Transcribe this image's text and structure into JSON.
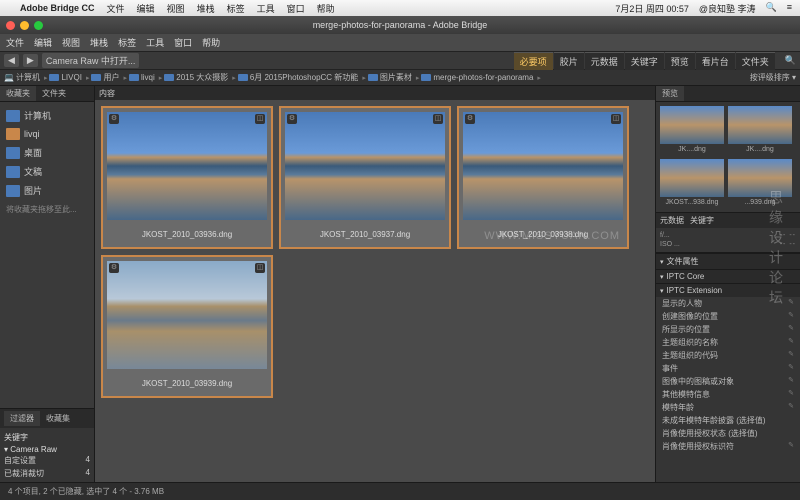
{
  "mac": {
    "app": "Adobe Bridge CC",
    "menus": [
      "文件",
      "编辑",
      "视图",
      "堆栈",
      "标签",
      "工具",
      "窗口",
      "帮助"
    ],
    "clock": "7月2日 周四 00:57",
    "user": "@良知塾 李涛",
    "search_icon": "🔍",
    "menu_icon": "≡"
  },
  "window": {
    "title": "merge-photos-for-panorama - Adobe Bridge"
  },
  "appmenu": [
    "文件",
    "编辑",
    "视图",
    "堆栈",
    "标签",
    "工具",
    "窗口",
    "帮助"
  ],
  "toolbar": {
    "cr_open": "Camera Raw 中打开...",
    "tabs": [
      "必要项",
      "胶片",
      "元数据",
      "关键字",
      "预览",
      "看片台",
      "文件夹"
    ],
    "sort": "按评级排序 ▾"
  },
  "crumbs": [
    "计算机",
    "LIVQI",
    "用户",
    "livqi",
    "2015 大众摄影",
    "6月 2015PhotoshopCC 新功能",
    "图片素材",
    "merge-photos-for-panorama"
  ],
  "left": {
    "tabs": [
      "收藏夹",
      "文件夹"
    ],
    "items": [
      {
        "icon": "comp",
        "label": "计算机"
      },
      {
        "icon": "home",
        "label": "livqi"
      },
      {
        "icon": "fold",
        "label": "桌面"
      },
      {
        "icon": "fold",
        "label": "文稿"
      },
      {
        "icon": "fold",
        "label": "图片"
      }
    ],
    "hint": "将收藏夹拖移至此...",
    "filter": {
      "tabs": [
        "过滤器",
        "收藏集"
      ],
      "section": "关键字",
      "group": "Camera Raw",
      "rows": [
        {
          "k": "自定设置",
          "v": "4"
        },
        {
          "k": "已裁消裁切",
          "v": "4"
        }
      ]
    }
  },
  "content": {
    "tab": "内容",
    "thumbs": [
      {
        "name": "JKOST_2010_03936.dng",
        "variant": ""
      },
      {
        "name": "JKOST_2010_03937.dng",
        "variant": ""
      },
      {
        "name": "JKOST_2010_03938.dng",
        "variant": ""
      },
      {
        "name": "JKOST_2010_03939.dng",
        "variant": "var2"
      }
    ]
  },
  "right": {
    "preview_tab": "预览",
    "minis": [
      {
        "l": "JK....dng"
      },
      {
        "l": "JK....dng"
      },
      {
        "l": "JKOST...938.dng"
      },
      {
        "l": "...939.dng"
      }
    ],
    "meta_tabs": [
      "元数据",
      "关键字"
    ],
    "meta": {
      "f": "f/...",
      "iso": "ISO ...",
      "exp": "--  --"
    },
    "sections": [
      "文件属性",
      "IPTC Core",
      "IPTC Extension"
    ],
    "iptc": [
      "显示的人物",
      "创建图像的位置",
      "所显示的位置",
      "主题组织的名称",
      "主题组织的代码",
      "事件",
      "图像中的图稿或对象",
      "其他模特信息",
      "模特年龄",
      "未成年模特年龄披露  (选择值)",
      "肖像使用授权状态  (选择值)",
      "肖像使用授权标识符"
    ]
  },
  "status": "4 个项目, 2 个已隐藏, 选中了 4 个 - 3.76 MB",
  "watermark": "思缘设计论坛",
  "url": "WWW.MISSYUAN.COM"
}
